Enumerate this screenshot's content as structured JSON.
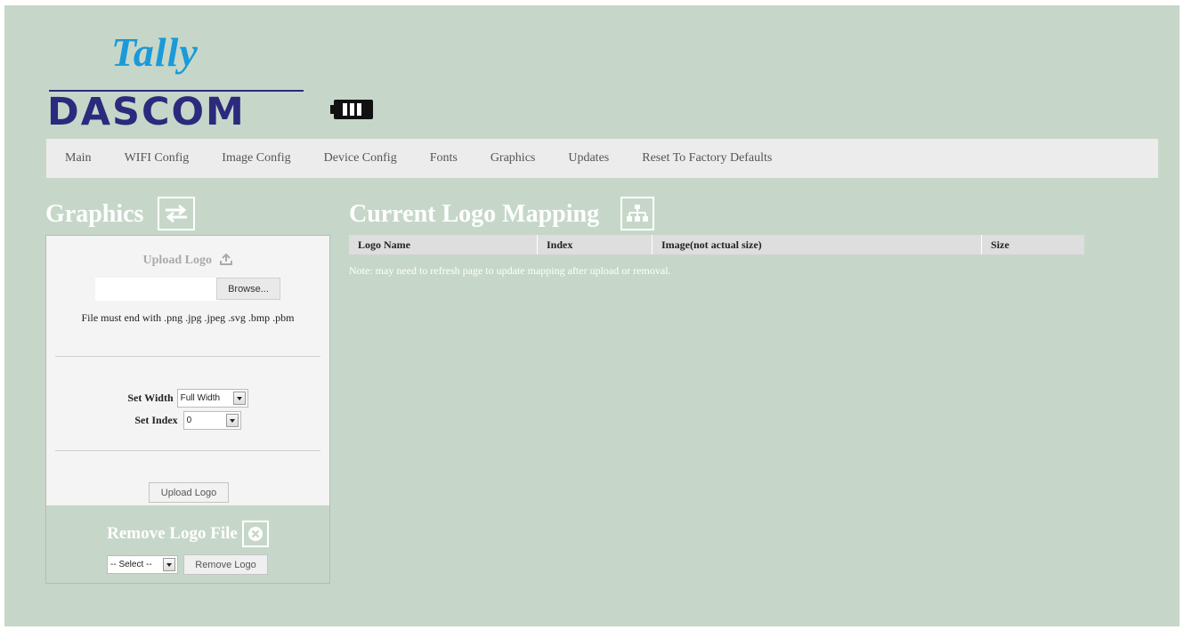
{
  "brand": {
    "tally": "Tally",
    "dascom": "DASCOM",
    "accent_blue": "#1b9ad7",
    "accent_navy": "#2c2a7d",
    "accent_red": "#d8232a"
  },
  "nav": {
    "items": [
      {
        "label": "Main"
      },
      {
        "label": "WIFI Config"
      },
      {
        "label": "Image Config"
      },
      {
        "label": "Device Config"
      },
      {
        "label": "Fonts"
      },
      {
        "label": "Graphics"
      },
      {
        "label": "Updates"
      },
      {
        "label": "Reset To Factory Defaults"
      }
    ]
  },
  "graphics": {
    "title": "Graphics",
    "icon": "swap-arrows-icon",
    "upload": {
      "heading": "Upload Logo",
      "heading_icon": "upload-icon",
      "file_value": "",
      "browse_label": "Browse...",
      "note": "File must end with .png .jpg .jpeg .svg .bmp .pbm",
      "width_label": "Set Width",
      "width_value": "Full Width",
      "index_label": "Set Index",
      "index_value": "0",
      "button_label": "Upload Logo"
    },
    "remove": {
      "title": "Remove Logo File",
      "icon": "close-circle-icon",
      "select_value": "-- Select --",
      "button_label": "Remove Logo"
    }
  },
  "mapping": {
    "title": "Current Logo Mapping",
    "icon": "sitemap-icon",
    "columns": [
      "Logo Name",
      "Index",
      "Image(not actual size)",
      "Size"
    ],
    "rows": [],
    "note": "Note: may need to refresh page to update mapping after upload or removal."
  },
  "colors": {
    "page_bg": "#c6d7c9",
    "nav_bg": "#ececec",
    "panel_bg": "#f4f4f4"
  }
}
